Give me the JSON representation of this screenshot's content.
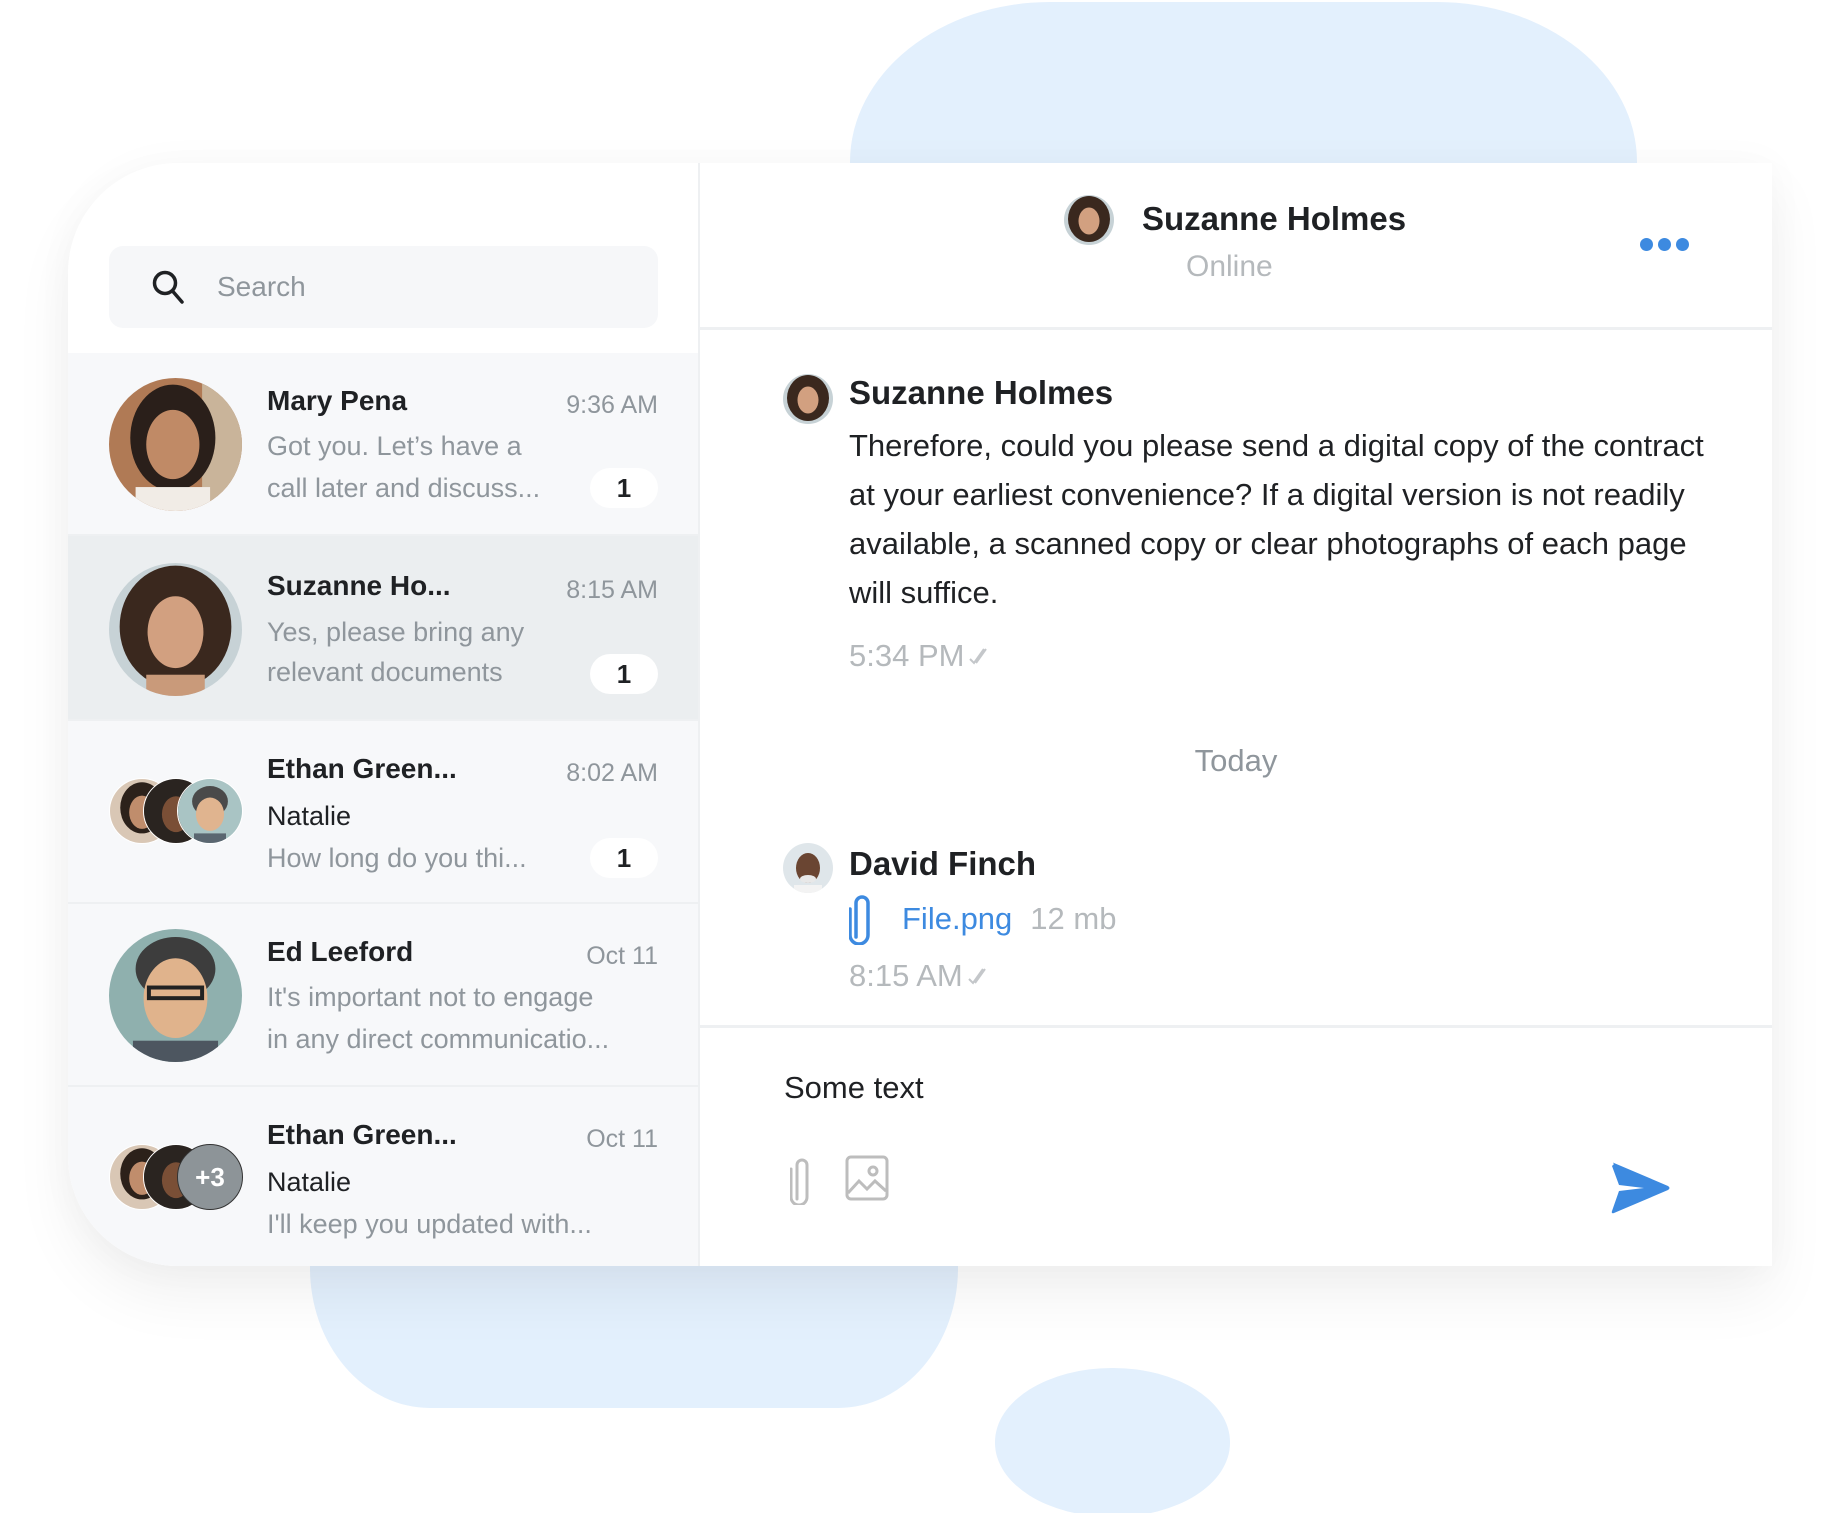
{
  "search": {
    "placeholder": "Search",
    "value": ""
  },
  "conversations": [
    {
      "name": "Mary Pena",
      "time": "9:36 AM",
      "preview_lines": [
        "Got you. Let’s have a",
        "call later and discuss..."
      ],
      "unread": "1",
      "active": false,
      "avatar": "mary-pena-avatar"
    },
    {
      "name": "Suzanne Ho...",
      "time": "8:15 AM",
      "preview_lines": [
        "Yes, please bring any",
        "relevant documents"
      ],
      "unread": "1",
      "active": true,
      "avatar": "suzanne-holmes-avatar"
    },
    {
      "name": "Ethan Green...",
      "time": "8:02 AM",
      "sender": "Natalie",
      "preview_lines": [
        "How long do you thi..."
      ],
      "unread": "1",
      "active": false,
      "avatar": "group-avatar"
    },
    {
      "name": "Ed Leeford",
      "time": "Oct 11",
      "preview_lines": [
        "It's important not to engage",
        "in any direct communicatio..."
      ],
      "unread": null,
      "active": false,
      "avatar": "ed-leeford-avatar"
    },
    {
      "name": "Ethan Green...",
      "time": "Oct 11",
      "sender": "Natalie",
      "preview_lines": [
        "I'll keep you updated with..."
      ],
      "unread": null,
      "extra_members": "+3",
      "active": false,
      "avatar": "group-avatar"
    }
  ],
  "chat": {
    "header": {
      "name": "Suzanne Holmes",
      "status": "Online"
    },
    "messages": [
      {
        "sender": "Suzanne Holmes",
        "text": "Therefore, could you please send a digital copy of the contract at your earliest convenience? If a digital version is not readily available, a scanned copy or clear photographs of each page will suffice.",
        "time": "5:34 PM",
        "status": "read"
      },
      {
        "sender": "David Finch",
        "attachment": {
          "name": "File.png",
          "size": "12 mb"
        },
        "time": "8:15 AM",
        "status": "read"
      }
    ],
    "day_divider": "Today",
    "composer": {
      "value": "Some text",
      "placeholder": ""
    }
  },
  "colors": {
    "accent": "#3d8ae0",
    "decor": "#e3f0fd",
    "muted": "#8f969c",
    "text": "#1f2124"
  }
}
